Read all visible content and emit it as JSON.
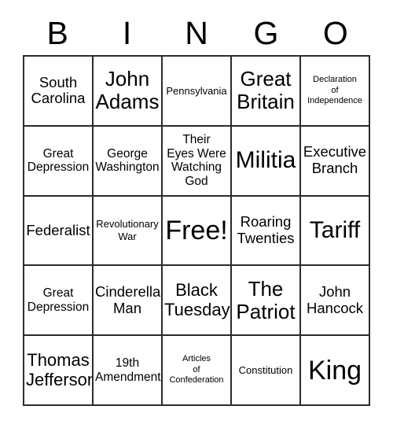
{
  "card": {
    "title_letters": [
      "B",
      "I",
      "N",
      "G",
      "O"
    ],
    "free_space_label": "Free!",
    "rows": [
      [
        {
          "text": "South\nCarolina",
          "size": "lg"
        },
        {
          "text": "John\nAdams",
          "size": "xxl"
        },
        {
          "text": "Pennsylvania",
          "size": "sm"
        },
        {
          "text": "Great\nBritain",
          "size": "xxl"
        },
        {
          "text": "Declaration\nof\nIndependence",
          "size": "xs"
        }
      ],
      [
        {
          "text": "Great\nDepression",
          "size": "md"
        },
        {
          "text": "George\nWashington",
          "size": "md"
        },
        {
          "text": "Their\nEyes Were\nWatching\nGod",
          "size": "md"
        },
        {
          "text": "Militia",
          "size": "huge"
        },
        {
          "text": "Executive\nBranch",
          "size": "lg"
        }
      ],
      [
        {
          "text": "Federalist",
          "size": "lg"
        },
        {
          "text": "Revolutionary\nWar",
          "size": "sm"
        },
        {
          "text": "Free!",
          "size": "free"
        },
        {
          "text": "Roaring\nTwenties",
          "size": "lg"
        },
        {
          "text": "Tariff",
          "size": "huge"
        }
      ],
      [
        {
          "text": "Great\nDepression",
          "size": "md"
        },
        {
          "text": "Cinderella\nMan",
          "size": "lg"
        },
        {
          "text": "Black\nTuesday",
          "size": "xl"
        },
        {
          "text": "The\nPatriot",
          "size": "xxl"
        },
        {
          "text": "John\nHancock",
          "size": "lg"
        }
      ],
      [
        {
          "text": "Thomas\nJefferson",
          "size": "xl"
        },
        {
          "text": "19th\nAmendment",
          "size": "md"
        },
        {
          "text": "Articles\nof\nConfederation",
          "size": "xs"
        },
        {
          "text": "Constitution",
          "size": "sm"
        },
        {
          "text": "King",
          "size": "free"
        }
      ]
    ]
  },
  "colors": {
    "border": "#2b2b2b",
    "text": "#000000",
    "background": "#ffffff"
  }
}
